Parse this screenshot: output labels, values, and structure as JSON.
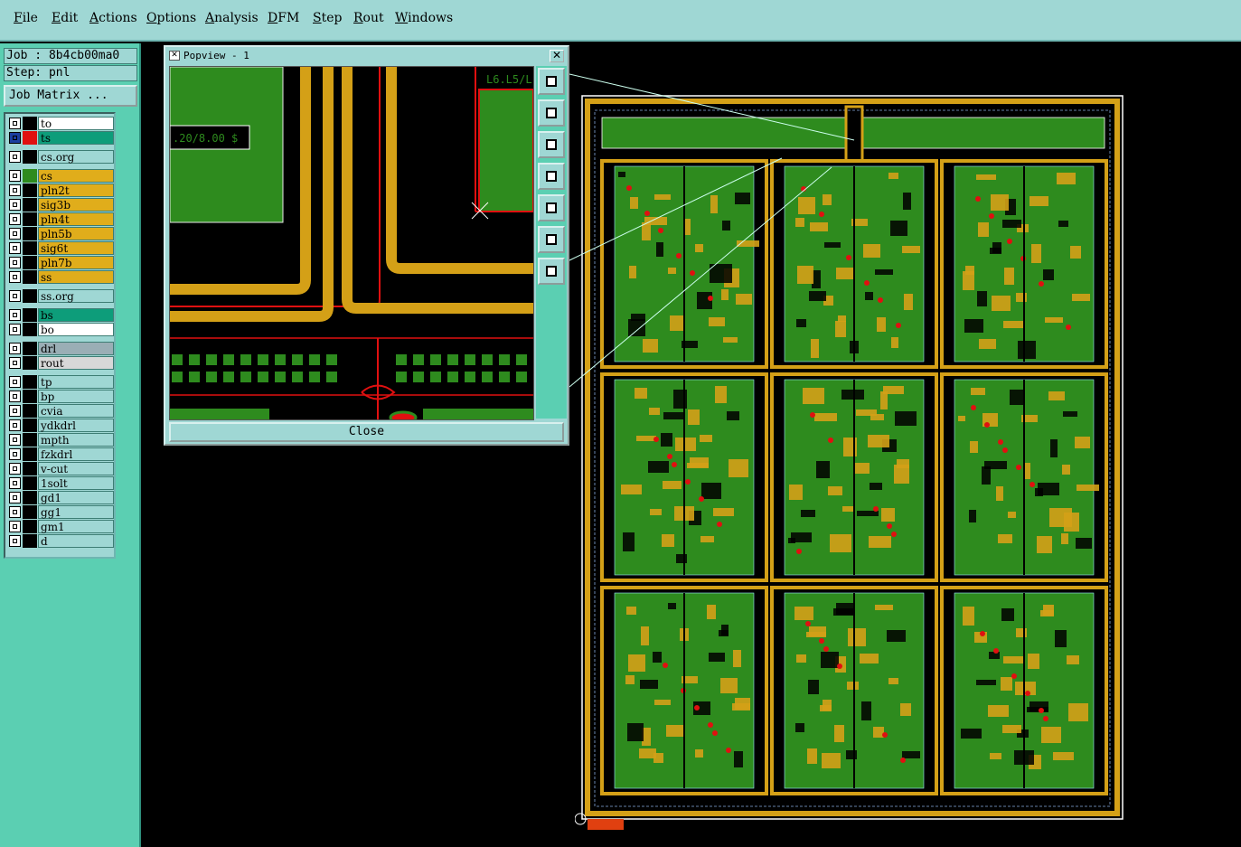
{
  "menu": [
    "File",
    "Edit",
    "Actions",
    "Options",
    "Analysis",
    "DFM",
    "Step",
    "Rout",
    "Windows"
  ],
  "job": {
    "job_label": "Job : 8b4cb00ma0",
    "step_label": "Step: pnl",
    "matrix_button": "Job Matrix ..."
  },
  "layers": [
    {
      "name": "to",
      "color": "#ffffff",
      "swatch": "#000000"
    },
    {
      "name": "ts",
      "color": "#0d9d7a",
      "swatch": "#e01010",
      "active": true
    },
    {
      "name": "cs.org",
      "color": "#9fd7d4",
      "swatch": "#000000"
    },
    {
      "name": "cs",
      "color": "#e0ad1b",
      "swatch": "#2e8b1e"
    },
    {
      "name": "pln2t",
      "color": "#e0ad1b",
      "swatch": "#000000"
    },
    {
      "name": "sig3b",
      "color": "#e0ad1b",
      "swatch": "#000000"
    },
    {
      "name": "pln4t",
      "color": "#e0ad1b",
      "swatch": "#000000"
    },
    {
      "name": "pln5b",
      "color": "#e0ad1b",
      "swatch": "#000000"
    },
    {
      "name": "sig6t",
      "color": "#e0ad1b",
      "swatch": "#000000"
    },
    {
      "name": "pln7b",
      "color": "#e0ad1b",
      "swatch": "#000000"
    },
    {
      "name": "ss",
      "color": "#e0ad1b",
      "swatch": "#000000"
    },
    {
      "name": "ss.org",
      "color": "#9fd7d4",
      "swatch": "#000000"
    },
    {
      "name": "bs",
      "color": "#0d9d7a",
      "swatch": "#000000"
    },
    {
      "name": "bo",
      "color": "#ffffff",
      "swatch": "#000000"
    },
    {
      "name": "drl",
      "color": "#9aaeb5",
      "swatch": "#000000"
    },
    {
      "name": "rout",
      "color": "#d8d8d8",
      "swatch": "#000000"
    },
    {
      "name": "tp",
      "color": "#9fd7d4",
      "swatch": "#000000"
    },
    {
      "name": "bp",
      "color": "#9fd7d4",
      "swatch": "#000000"
    },
    {
      "name": "cvia",
      "color": "#9fd7d4",
      "swatch": "#000000"
    },
    {
      "name": "ydkdrl",
      "color": "#9fd7d4",
      "swatch": "#000000"
    },
    {
      "name": "mpth",
      "color": "#9fd7d4",
      "swatch": "#000000"
    },
    {
      "name": "fzkdrl",
      "color": "#9fd7d4",
      "swatch": "#000000"
    },
    {
      "name": "v-cut",
      "color": "#9fd7d4",
      "swatch": "#000000"
    },
    {
      "name": "1solt",
      "color": "#9fd7d4",
      "swatch": "#000000"
    },
    {
      "name": "gd1",
      "color": "#9fd7d4",
      "swatch": "#000000"
    },
    {
      "name": "gg1",
      "color": "#9fd7d4",
      "swatch": "#000000"
    },
    {
      "name": "gm1",
      "color": "#9fd7d4",
      "swatch": "#000000"
    },
    {
      "name": "d",
      "color": "#9fd7d4",
      "swatch": "#000000"
    }
  ],
  "popview": {
    "title": "Popview - 1",
    "close_label": "Close",
    "text_left": ".20/8.00 $",
    "text_right": "L6.L5/L"
  },
  "colors": {
    "pcb_green": "#2e8b1e",
    "copper": "#d4a017",
    "menu_bg": "#9fd7d4",
    "panel_bg": "#5bcfb2",
    "outline": "#ffffff"
  }
}
